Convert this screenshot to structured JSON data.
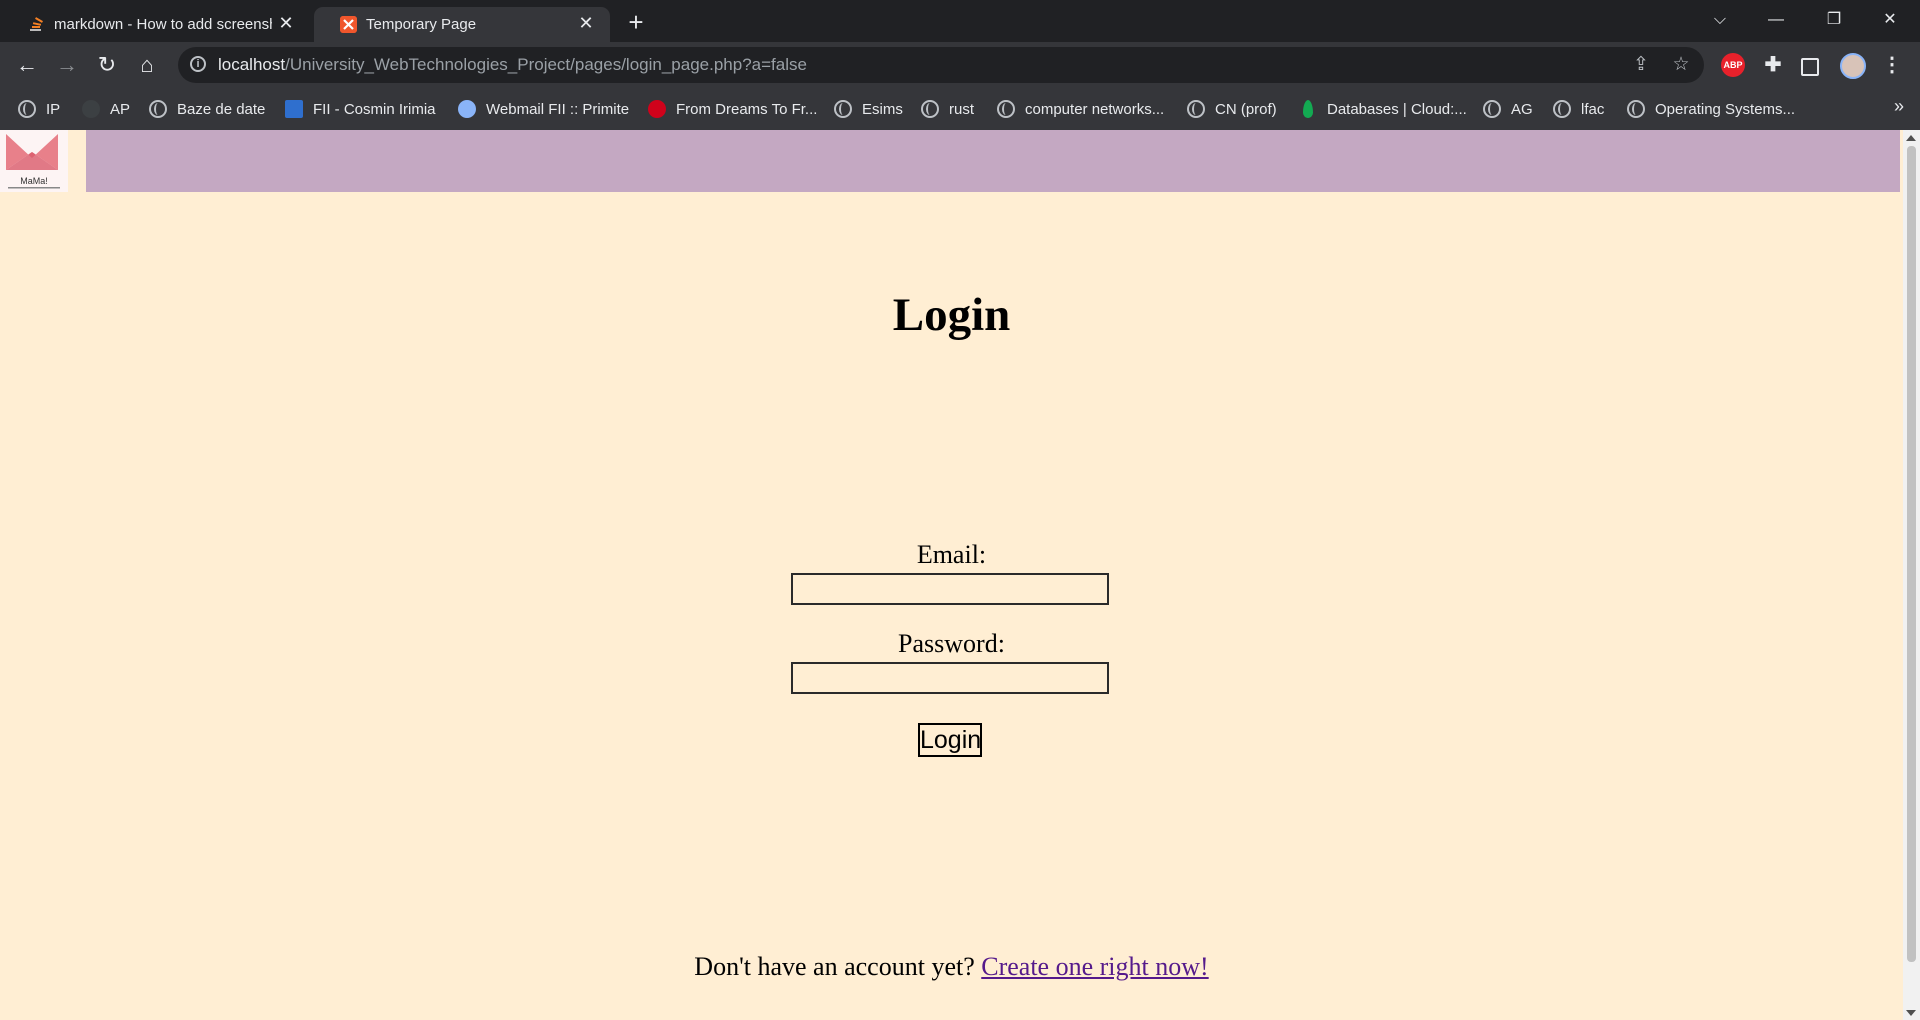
{
  "browser": {
    "tabs": [
      {
        "title": "markdown - How to add screenshot",
        "active": false
      },
      {
        "title": "Temporary Page",
        "active": true
      }
    ],
    "url_host": "localhost",
    "url_path": "/University_WebTechnologies_Project/pages/login_page.php?a=false",
    "bookmarks": [
      {
        "label": "IP",
        "icon": "globe"
      },
      {
        "label": "AP",
        "icon": "ap-icon"
      },
      {
        "label": "Baze de date",
        "icon": "globe"
      },
      {
        "label": "FII - Cosmin Irimia",
        "icon": "fii-icon"
      },
      {
        "label": "Webmail FII :: Primite",
        "icon": "webmail-icon"
      },
      {
        "label": "From Dreams To Fr...",
        "icon": "red-circle-icon"
      },
      {
        "label": "Esims",
        "icon": "globe"
      },
      {
        "label": "rust",
        "icon": "globe"
      },
      {
        "label": "computer networks...",
        "icon": "globe"
      },
      {
        "label": "CN (prof)",
        "icon": "globe"
      },
      {
        "label": "Databases | Cloud:...",
        "icon": "mongodb-leaf-icon"
      },
      {
        "label": "AG",
        "icon": "globe"
      },
      {
        "label": "lfac",
        "icon": "globe"
      },
      {
        "label": "Operating Systems...",
        "icon": "globe"
      }
    ],
    "extension_abp": "ABP"
  },
  "page": {
    "logo_text": "MaMa!",
    "title": "Login",
    "email_label": "Email:",
    "password_label": "Password:",
    "login_button": "Login",
    "signup_prompt": "Don't have an account yet?",
    "signup_link": "Create one right now!"
  },
  "colors": {
    "background": "#ffeed3",
    "header_bar": "#c4a8c2",
    "link": "#551a8b"
  }
}
